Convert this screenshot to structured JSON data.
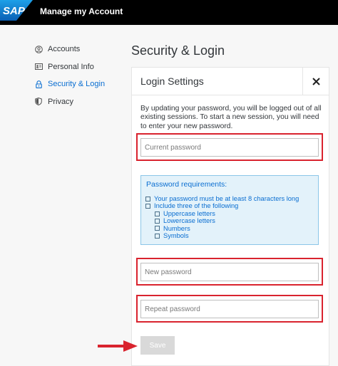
{
  "header": {
    "logo_text": "SAP",
    "app_title": "Manage my Account"
  },
  "sidebar": {
    "items": [
      {
        "label": "Accounts",
        "icon": "user-icon"
      },
      {
        "label": "Personal Info",
        "icon": "id-card-icon"
      },
      {
        "label": "Security & Login",
        "icon": "lock-icon",
        "active": true
      },
      {
        "label": "Privacy",
        "icon": "shield-icon"
      }
    ]
  },
  "page": {
    "title": "Security & Login"
  },
  "dialog": {
    "title": "Login Settings",
    "info_text": "By updating your password, you will be logged out of all existing sessions. To start a new session, you will need to enter your new password.",
    "current_password_placeholder": "Current password",
    "requirements_title": "Password requirements:",
    "requirements": [
      "Your password must be at least 8 characters long",
      "Include three of the following"
    ],
    "sub_requirements": [
      "Uppercase letters",
      "Lowercase letters",
      "Numbers",
      "Symbols"
    ],
    "new_password_placeholder": "New password",
    "repeat_password_placeholder": "Repeat password",
    "save_label": "Save"
  },
  "colors": {
    "accent": "#0a6ed1",
    "highlight": "#d9232e",
    "requirements_bg": "#e3f2fa",
    "save_disabled": "#d9d9d9"
  }
}
